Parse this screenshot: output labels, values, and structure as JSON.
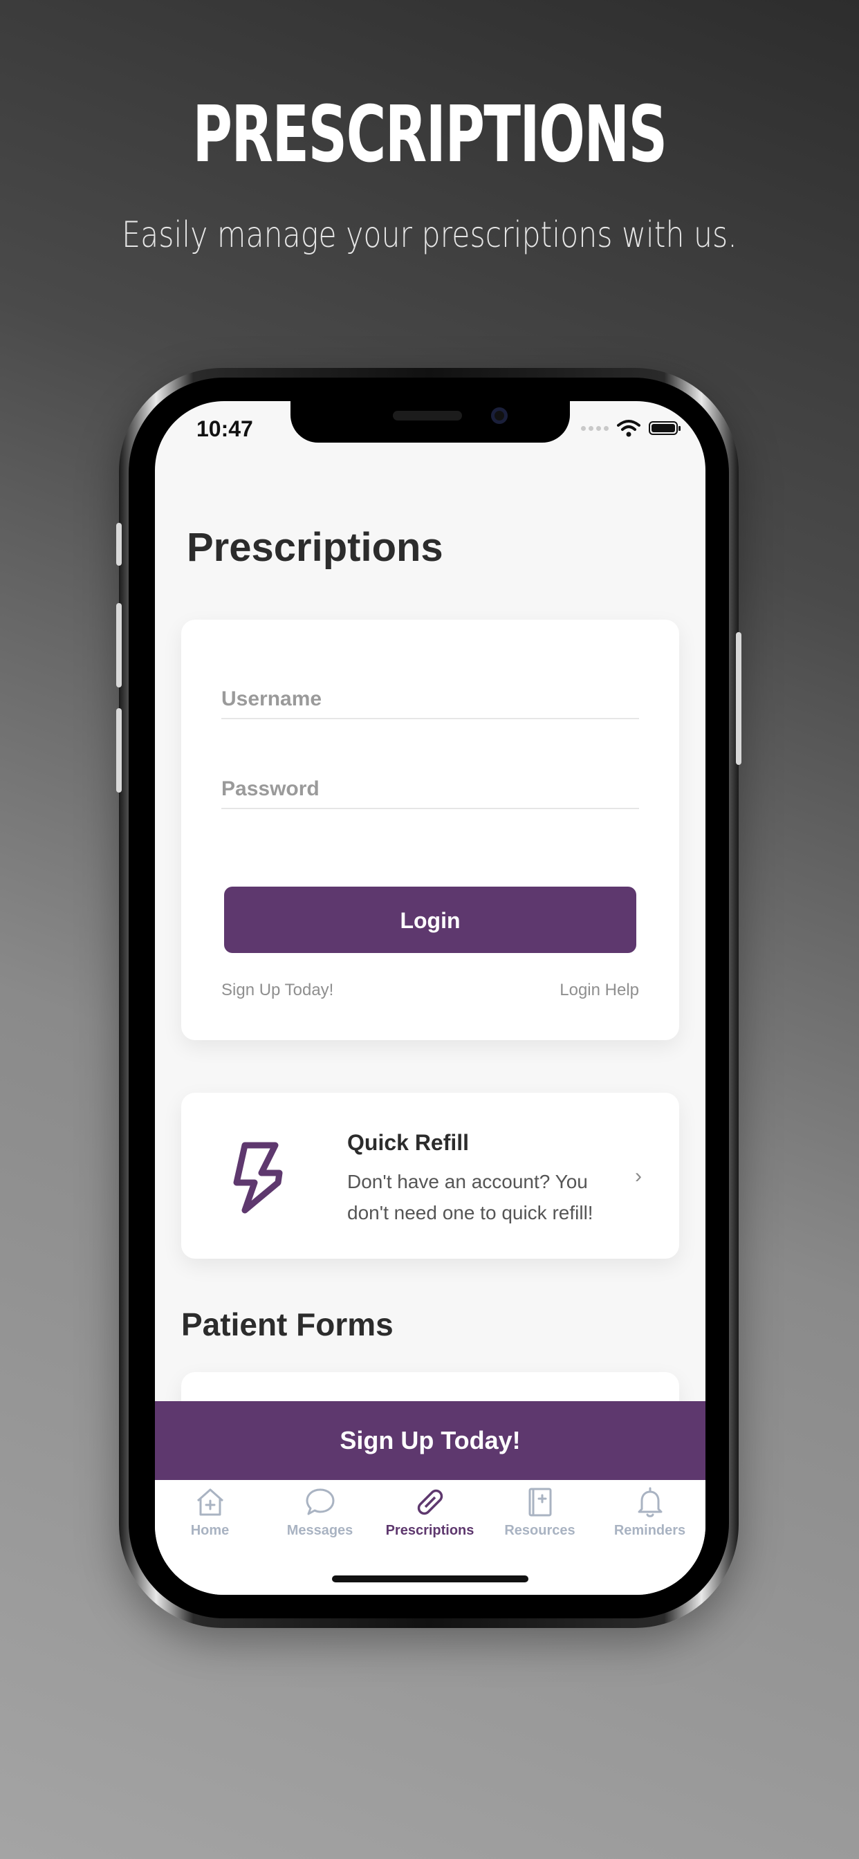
{
  "hero": {
    "title": "PRESCRIPTIONS",
    "subtitle": "Easily manage your prescriptions with us."
  },
  "status_bar": {
    "time": "10:47"
  },
  "page": {
    "title": "Prescriptions"
  },
  "login": {
    "username_placeholder": "Username",
    "password_placeholder": "Password",
    "login_label": "Login",
    "signup_link": "Sign Up Today!",
    "help_link": "Login Help"
  },
  "quick_refill": {
    "title": "Quick Refill",
    "description": "Don't have an account? You don't need one to quick refill!",
    "chevron": "›",
    "icon": "lightning-bolt-icon"
  },
  "patient_forms": {
    "title": "Patient Forms"
  },
  "signup_bar": {
    "label": "Sign Up Today!"
  },
  "tabs": [
    {
      "label": "Home",
      "icon": "home-icon",
      "active": false
    },
    {
      "label": "Messages",
      "icon": "chat-bubble-icon",
      "active": false
    },
    {
      "label": "Prescriptions",
      "icon": "pill-icon",
      "active": true
    },
    {
      "label": "Resources",
      "icon": "book-icon",
      "active": false
    },
    {
      "label": "Reminders",
      "icon": "bell-icon",
      "active": false
    }
  ],
  "colors": {
    "brand": "#5e386e",
    "inactive_tab": "#a9b3c2",
    "screen_bg": "#f7f7f7"
  }
}
